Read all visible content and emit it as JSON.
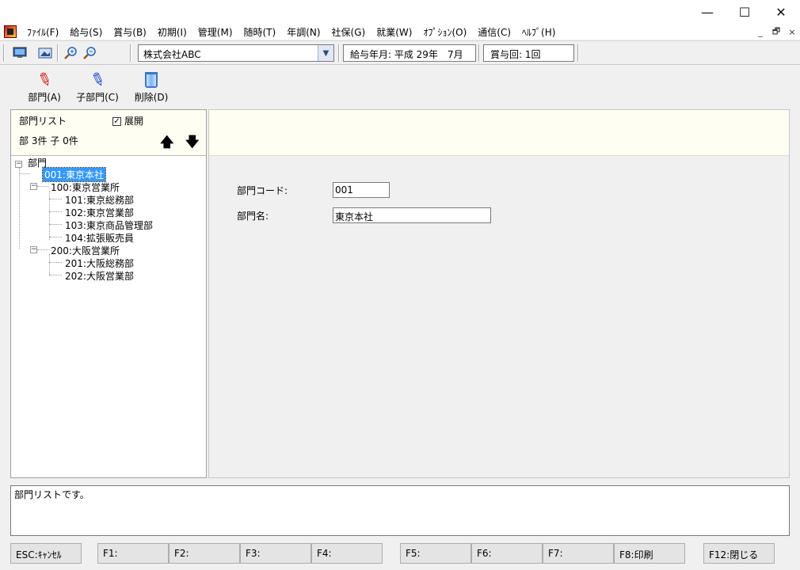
{
  "window": {
    "minimize_glyph": "—",
    "maximize_glyph": "☐",
    "close_glyph": "✕"
  },
  "menu": {
    "items": [
      "ﾌｧｲﾙ(F)",
      "給与(S)",
      "賞与(B)",
      "初期(I)",
      "管理(M)",
      "随時(T)",
      "年調(N)",
      "社保(G)",
      "就業(W)",
      "ｵﾌﾟｼｮﾝ(O)",
      "通信(C)",
      "ﾍﾙﾌﾟ(H)"
    ],
    "mdi_minimize": "_",
    "mdi_restore": "🗗",
    "mdi_close": "×"
  },
  "toolbar": {
    "company": "株式会社ABC",
    "pay_period": "給与年月: 平成 29年　7月",
    "bonus_round": "賞与回: 1回",
    "icons": [
      "monitor-icon",
      "picture-icon",
      "zoom-in-icon",
      "zoom-out-icon"
    ]
  },
  "actions": {
    "dept": "部門(A)",
    "subdept": "子部門(C)",
    "delete": "削除(D)"
  },
  "left": {
    "title": "部門リスト",
    "expand_label": "展開",
    "expand_checked": true,
    "count": "部 3件 子 0件",
    "up_arrow": "🡅",
    "down_arrow": "🡇",
    "tree": {
      "root": "部門",
      "items": [
        {
          "label": "001:東京本社",
          "level": 1,
          "selected": true
        },
        {
          "label": "100:東京営業所",
          "level": 1,
          "selected": false
        },
        {
          "label": "101:東京総務部",
          "level": 2,
          "selected": false
        },
        {
          "label": "102:東京営業部",
          "level": 2,
          "selected": false
        },
        {
          "label": "103:東京商品管理部",
          "level": 2,
          "selected": false
        },
        {
          "label": "104:拡張販売員",
          "level": 2,
          "selected": false
        },
        {
          "label": "200:大阪営業所",
          "level": 1,
          "selected": false
        },
        {
          "label": "201:大阪総務部",
          "level": 2,
          "selected": false
        },
        {
          "label": "202:大阪営業部",
          "level": 2,
          "selected": false
        }
      ]
    }
  },
  "form": {
    "code_label": "部門コード:",
    "code_value": "001",
    "name_label": "部門名:",
    "name_value": "東京本社"
  },
  "status_text": "部門リストです。",
  "fkeys": {
    "esc": "ESC:ｷｬﾝｾﾙ",
    "f1": "F1:",
    "f2": "F2:",
    "f3": "F3:",
    "f4": "F4:",
    "f5": "F5:",
    "f6": "F6:",
    "f7": "F7:",
    "f8": "F8:印刷",
    "f12": "F12:閉じる"
  }
}
